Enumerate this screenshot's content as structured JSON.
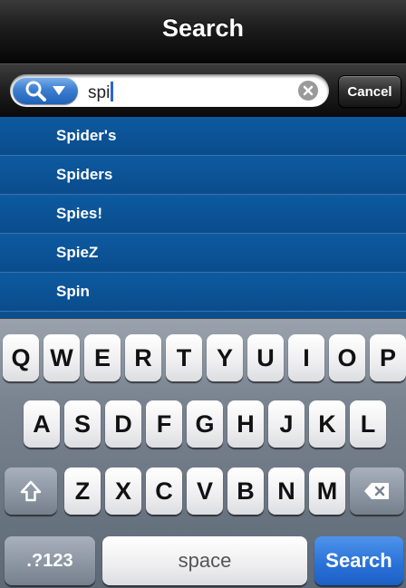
{
  "title_bar": {
    "title": "Search"
  },
  "search_bar": {
    "query": "spi",
    "cancel_label": "Cancel",
    "scope_icon": "search-scope-icon",
    "clear_icon": "clear-x-icon"
  },
  "suggestions": [
    "Spider's",
    "Spiders",
    "Spies!",
    "SpieZ",
    "Spin"
  ],
  "keyboard": {
    "row1": [
      "Q",
      "W",
      "E",
      "R",
      "T",
      "Y",
      "U",
      "I",
      "O",
      "P"
    ],
    "row2": [
      "A",
      "S",
      "D",
      "F",
      "G",
      "H",
      "J",
      "K",
      "L"
    ],
    "row3": [
      "Z",
      "X",
      "C",
      "V",
      "B",
      "N",
      "M"
    ],
    "shift_icon": "shift-arrow-icon",
    "backspace_icon": "backspace-icon",
    "numbers_label": ".?123",
    "space_label": "space",
    "search_label": "Search"
  },
  "colors": {
    "list_blue": "#0a4c8c",
    "search_key_blue": "#2a73d9",
    "scope_blue": "#3d7fd0"
  }
}
